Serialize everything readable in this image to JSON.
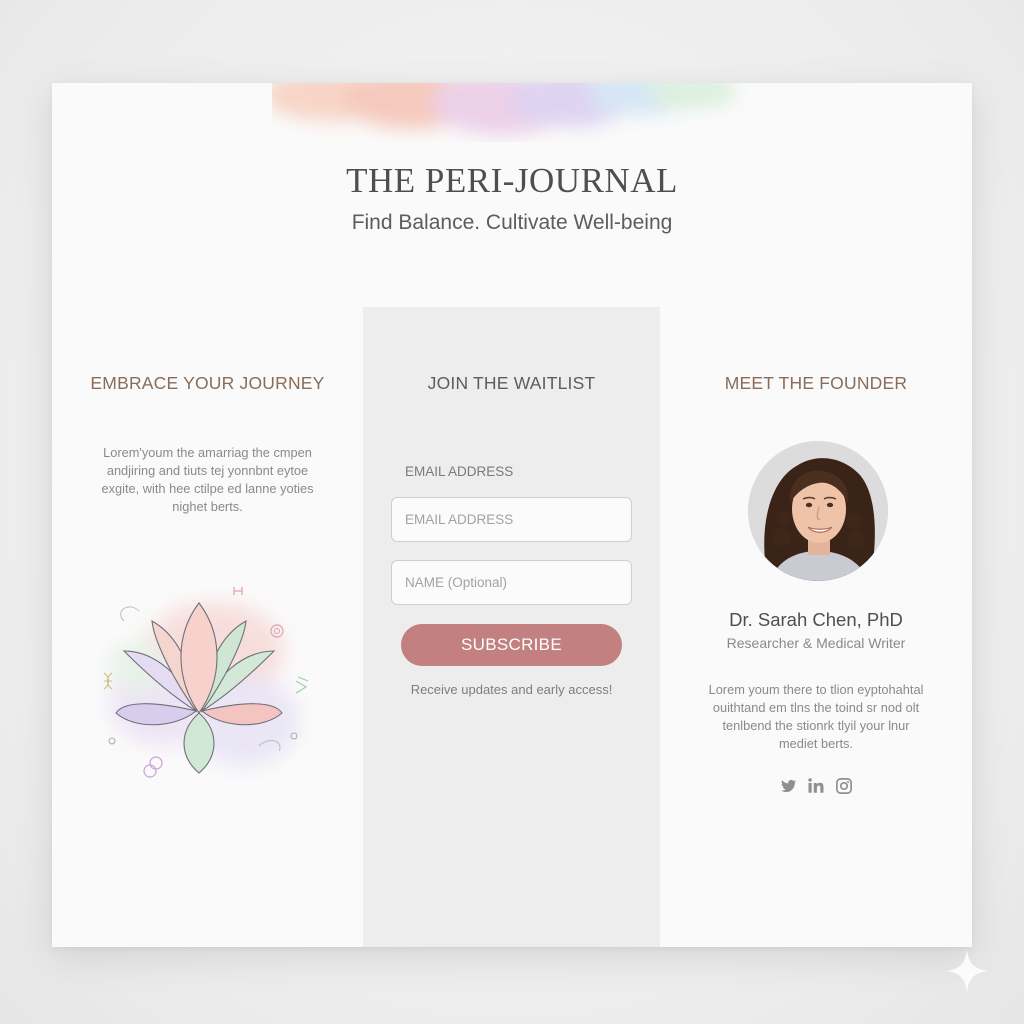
{
  "header": {
    "title": "THE PERI-JOURNAL",
    "tagline": "Find Balance. Cultivate Well-being"
  },
  "left": {
    "heading": "EMBRACE YOUR JOURNEY",
    "body": "Lorem'youm the amarriag the cmpen andjiring and tiuts tej yonnbnt eytoe exgite, with hee ctilpe ed lanne yoties nighet berts.",
    "illustration": "lotus-illustration"
  },
  "waitlist": {
    "heading": "JOIN THE WAITLIST",
    "email_label": "EMAIL ADDRESS",
    "email_placeholder": "EMAIL ADDRESS",
    "name_placeholder": "NAME (Optional)",
    "subscribe_label": "SUBSCRIBE",
    "helper": "Receive updates and early access!"
  },
  "founder": {
    "heading": "MEET THE FOUNDER",
    "name": "Dr. Sarah Chen, PhD",
    "role": "Researcher & Medical Writer",
    "bio": "Lorem youm there to tlion eyptohahtal ouithtand em tlns the toind sr nod olt tenlbend the stionrk tlyil your lnur mediet berts.",
    "social": [
      "twitter-icon",
      "linkedin-icon",
      "instagram-icon"
    ]
  },
  "colors": {
    "accent": "#c28080",
    "heading_brown": "#8a6c58",
    "panel": "#ededed"
  }
}
